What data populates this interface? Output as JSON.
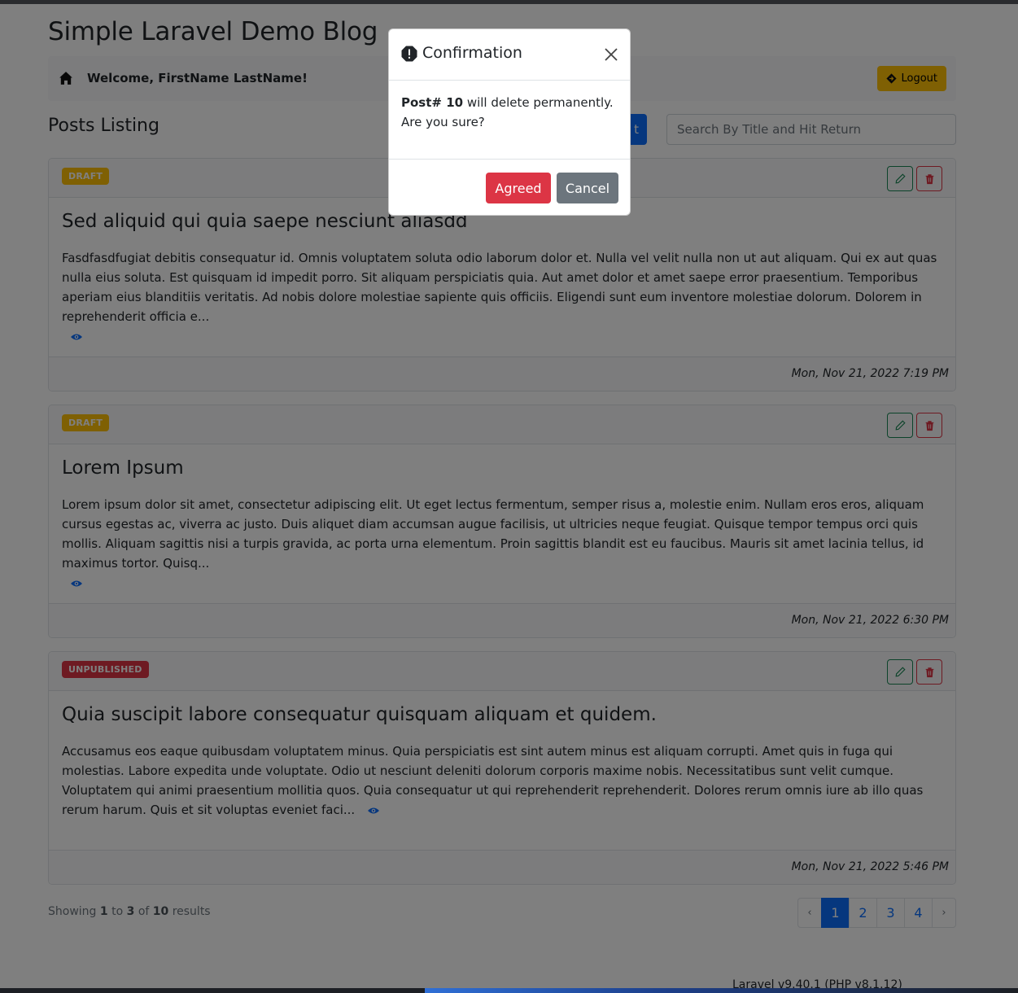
{
  "app": {
    "title": "Simple Laravel Demo Blog",
    "welcome": "Welcome, FirstName LastName!",
    "logout_label": "Logout"
  },
  "listing": {
    "title": "Posts Listing",
    "new_button_label": "t",
    "search_placeholder": "Search By Title and Hit Return"
  },
  "posts": [
    {
      "status": "DRAFT",
      "status_color": "#ffc107",
      "title": "Sed aliquid qui quia saepe nesciunt aliasdd",
      "excerpt": "Fasdfasdfugiat debitis consequatur id. Omnis voluptatem soluta odio laborum dolor et. Nulla vel velit nulla non ut aut aliquam. Qui ex aut quas nulla eius soluta. Est quisquam id impedit porro. Sit aliquam perspiciatis quia. Aut amet dolor et amet saepe error praesentium. Temporibus aperiam eius blanditiis veritatis. Ad nobis dolore molestiae sapiente quis officiis. Eligendi sunt eum inventore molestiae dolorum. Dolorem in reprehenderit officia e...",
      "date": "Mon, Nov 21, 2022 7:19 PM"
    },
    {
      "status": "DRAFT",
      "status_color": "#ffc107",
      "title": "Lorem Ipsum",
      "excerpt": "Lorem ipsum dolor sit amet, consectetur adipiscing elit. Ut eget lectus fermentum, semper risus a, molestie enim. Nullam eros eros, aliquam cursus egestas ac, viverra ac justo. Duis aliquet diam accumsan augue facilisis, ut ultricies neque feugiat. Quisque tempor tempus orci quis mollis. Aliquam sagittis nisi a turpis gravida, ac porta urna elementum. Proin sagittis blandit est eu faucibus. Mauris sit amet lacinia tellus, id maximus tortor. Quisq...",
      "date": "Mon, Nov 21, 2022 6:30 PM"
    },
    {
      "status": "UNPUBLISHED",
      "status_color": "#dc3545",
      "title": "Quia suscipit labore consequatur quisquam aliquam et quidem.",
      "excerpt": "Accusamus eos eaque quibusdam voluptatem minus. Quia perspiciatis est sint autem minus est aliquam corrupti. Amet quis in fuga qui molestias. Labore expedita unde voluptate. Odio ut nesciunt deleniti dolorum corporis maxime nobis. Necessitatibus sunt velit cumque. Voluptatem qui animi praesentium mollitia quos. Quia consequatur ut qui reprehenderit reprehenderit. Dolores rerum omnis iure ab illo quas rerum harum. Quis et sit voluptas eveniet faci...",
      "date": "Mon, Nov 21, 2022 5:46 PM"
    }
  ],
  "pagination": {
    "showing_prefix": "Showing",
    "from": "1",
    "to_word": "to",
    "to": "3",
    "of_word": "of",
    "total": "10",
    "results_word": "results",
    "prev": "‹",
    "next": "›",
    "pages": [
      "1",
      "2",
      "3",
      "4"
    ],
    "current": "1"
  },
  "footer": {
    "version": "Laravel v9.40.1 (PHP v8.1.12)"
  },
  "modal": {
    "title": "Confirmation",
    "post_label": "Post# 10",
    "message": " will delete permanently.",
    "question": "Are you sure?",
    "agree_label": "Agreed",
    "cancel_label": "Cancel"
  },
  "icons": {
    "home": "home-icon",
    "logout": "sign-out-diamond-icon",
    "edit": "pencil-icon",
    "delete": "trash-icon",
    "view": "eye-icon",
    "alert": "exclamation-octagon-icon",
    "close": "close-icon"
  }
}
